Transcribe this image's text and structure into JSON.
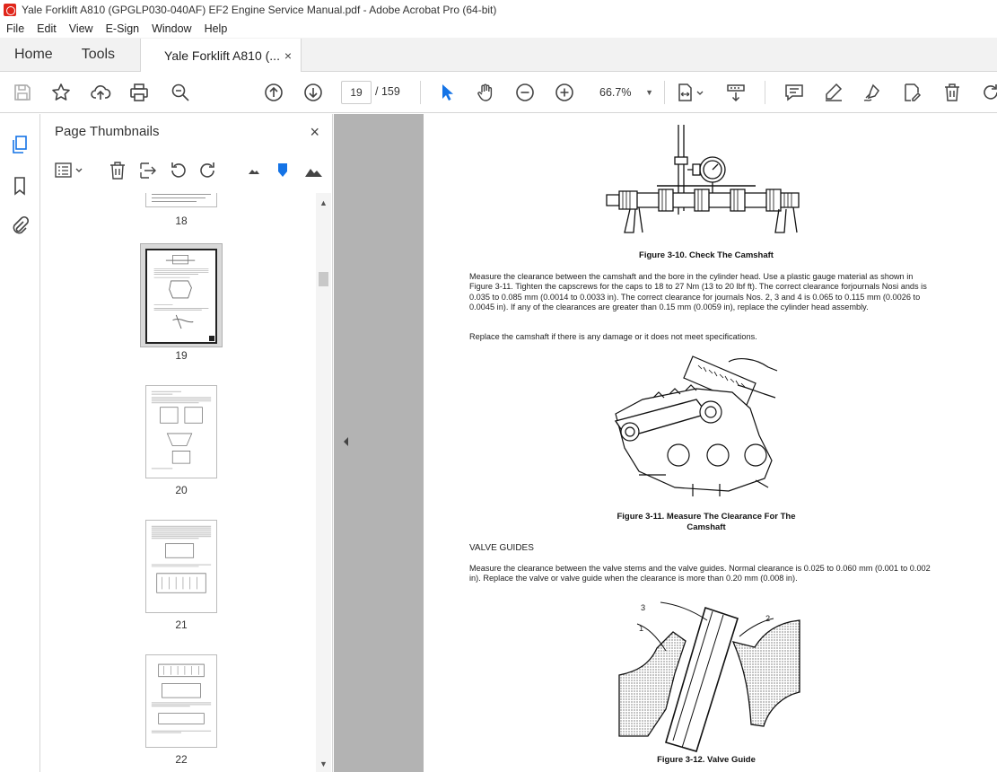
{
  "window": {
    "title": "Yale Forklift A810 (GPGLP030-040AF) EF2 Engine Service Manual.pdf - Adobe Acrobat Pro (64-bit)"
  },
  "menu": [
    "File",
    "Edit",
    "View",
    "E-Sign",
    "Window",
    "Help"
  ],
  "tabs": {
    "home": "Home",
    "tools": "Tools",
    "document": "Yale Forklift A810 (...",
    "close": "×"
  },
  "toolbar": {
    "current_page": "19",
    "total_pages": "/  159",
    "zoom": "66.7%"
  },
  "panel": {
    "title": "Page Thumbnails",
    "close": "×",
    "thumbnails": [
      {
        "page": "18"
      },
      {
        "page": "19",
        "selected": true
      },
      {
        "page": "20"
      },
      {
        "page": "21"
      },
      {
        "page": "22"
      }
    ]
  },
  "document": {
    "fig_3_10_caption": "Figure 3-10. Check The Camshaft",
    "para1": "Measure the clearance between the camshaft and the bore in the cylinder head. Use a plastic gauge material as shown in Figure 3-11. Tighten the capscrews for the caps to 18 to 27 Nm (13 to 20 lbf ft). The correct clearance forjournals Nosi ands is 0.035 to 0.085 mm (0.0014 to 0.0033 in). The correct clearance for journals Nos. 2, 3 and 4 is 0.065 to 0.115 mm (0.0026 to 0.0045 in). If any of the clearances are greater than 0.15 mm (0.0059 in), replace the cylinder head assembly.",
    "para2": "Replace the camshaft if there is any damage or it does not meet specifications.",
    "fig_3_11_caption_line1": "Figure 3-11. Measure The Clearance For The",
    "fig_3_11_caption_line2": "Camshaft",
    "section_valve_guides": "VALVE GUIDES",
    "para3": "Measure the clearance between the valve stems and the valve guides. Normal clearance is 0.025 to 0.060 mm (0.001 to 0.002 in). Replace the valve or valve guide when the clearance is more than 0.20 mm (0.008 in).",
    "fig_3_12_labels": {
      "one": "1",
      "two": "2",
      "three": "3"
    },
    "fig_3_12_caption": "Figure 3-12. Valve Guide"
  },
  "colors": {
    "accent_blue": "#1473e6",
    "adobe_red": "#e0261b",
    "doc_background": "#b3b3b3"
  }
}
